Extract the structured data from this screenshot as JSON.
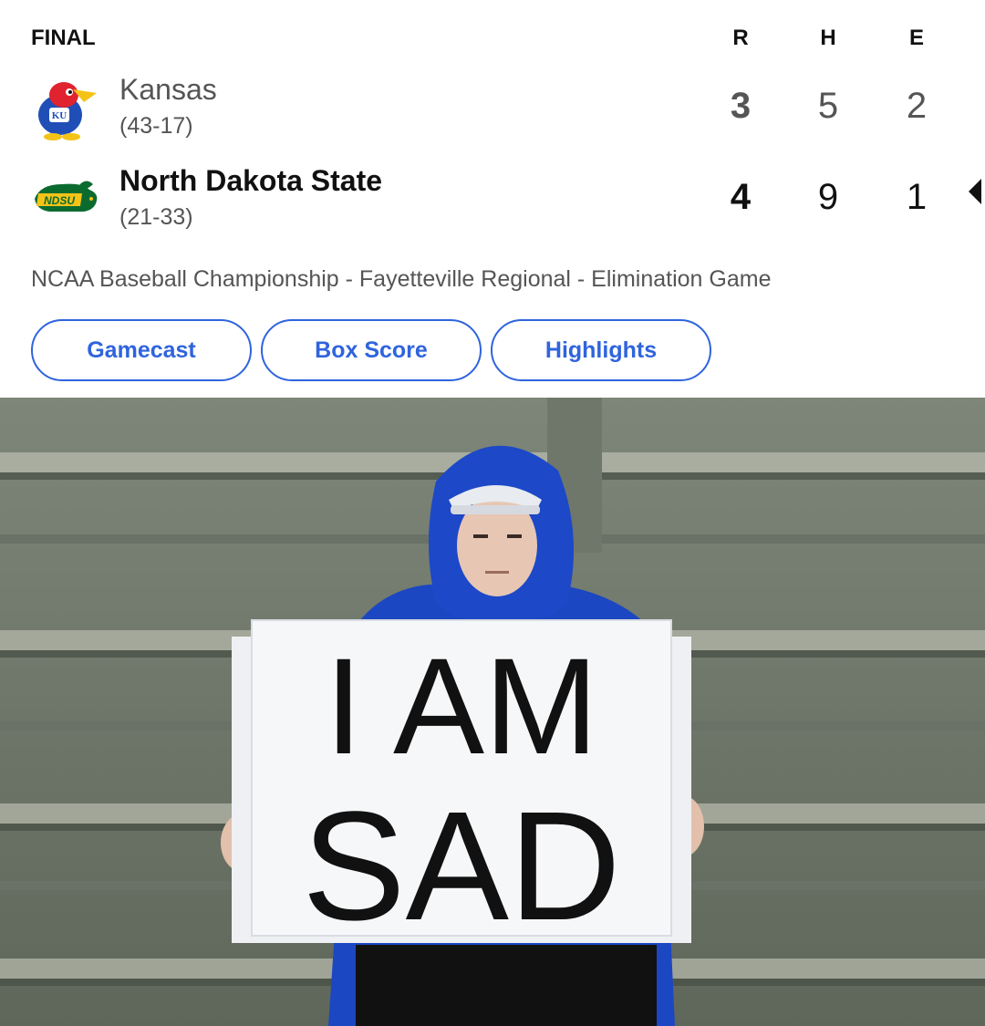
{
  "scoreboard": {
    "status": "FINAL",
    "columns": [
      "R",
      "H",
      "E"
    ],
    "teams": [
      {
        "name": "Kansas",
        "record": "(43-17)",
        "logo": "kansas-jayhawk-logo",
        "R": "3",
        "H": "5",
        "E": "2",
        "winner": false
      },
      {
        "name": "North Dakota State",
        "record": "(21-33)",
        "logo": "ndsu-bison-logo",
        "R": "4",
        "H": "9",
        "E": "1",
        "winner": true
      }
    ],
    "game_note": "NCAA Baseball Championship - Fayetteville Regional - Elimination Game",
    "buttons": [
      "Gamecast",
      "Box Score",
      "Highlights"
    ],
    "accent_color": "#2f64dd"
  },
  "photo": {
    "sign_line1": "I AM",
    "sign_line2": "SAD"
  }
}
